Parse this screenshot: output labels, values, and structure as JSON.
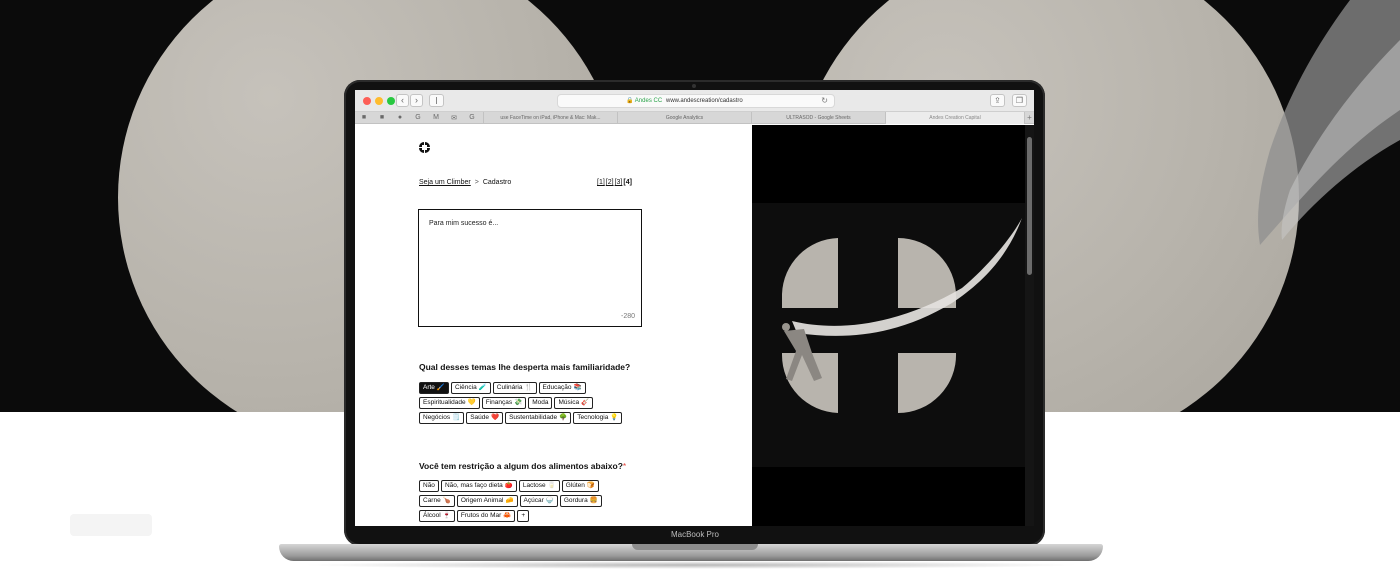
{
  "browser": {
    "address_secure": "🔒 Andes CC",
    "url": "www.andescreation/cadastro",
    "tabs": [
      "use FaceTime on iPad, iPhone & Mac: Mak...",
      "Google Analytics",
      "ULTRASOD - Google Sheets",
      "Andes Creation Capital"
    ]
  },
  "device_label": "MacBook Pro",
  "page": {
    "breadcrumb": {
      "link": "Seja um Climber",
      "separator": ">",
      "current": "Cadastro"
    },
    "pager": [
      "[1]",
      "[2]",
      "[3]",
      "[4]"
    ],
    "pager_current_index": 3,
    "textarea": {
      "placeholder": "Para mim sucesso é...",
      "counter": "-280"
    },
    "question1": {
      "title": "Qual desses temas lhe desperta mais familiaridade?",
      "rows": [
        [
          {
            "label": "Arte",
            "emoji": "🖌️",
            "selected": true
          },
          {
            "label": "Ciência",
            "emoji": "🧪"
          },
          {
            "label": "Culinária",
            "emoji": "🍴"
          },
          {
            "label": "Educação",
            "emoji": "📚"
          }
        ],
        [
          {
            "label": "Espiritualidade",
            "emoji": "💛"
          },
          {
            "label": "Finanças",
            "emoji": "💸"
          },
          {
            "label": "Moda",
            "emoji": ""
          },
          {
            "label": "Música",
            "emoji": "🎸"
          }
        ],
        [
          {
            "label": "Negócios",
            "emoji": "🗒️"
          },
          {
            "label": "Saúde",
            "emoji": "❤️"
          },
          {
            "label": "Sustentabilidade",
            "emoji": "🌳"
          },
          {
            "label": "Tecnologia",
            "emoji": "💡"
          }
        ]
      ]
    },
    "question2": {
      "title": "Você tem restrição a algum dos alimentos abaixo?",
      "required_mark": "*",
      "rows": [
        [
          {
            "label": "Não",
            "emoji": ""
          },
          {
            "label": "Não, mas faço dieta",
            "emoji": "🍅"
          },
          {
            "label": "Lactose",
            "emoji": "🥛"
          },
          {
            "label": "Glúten",
            "emoji": "🍞"
          }
        ],
        [
          {
            "label": "Carne",
            "emoji": "🍗"
          },
          {
            "label": "Origem Animal",
            "emoji": "🧀"
          },
          {
            "label": "Açúcar",
            "emoji": "🍚"
          },
          {
            "label": "Gordura",
            "emoji": "🍔"
          }
        ],
        [
          {
            "label": "Álcool",
            "emoji": "🍷"
          },
          {
            "label": "Frutos do Mar",
            "emoji": "🦀"
          },
          {
            "label": "+",
            "emoji": ""
          }
        ]
      ]
    }
  }
}
